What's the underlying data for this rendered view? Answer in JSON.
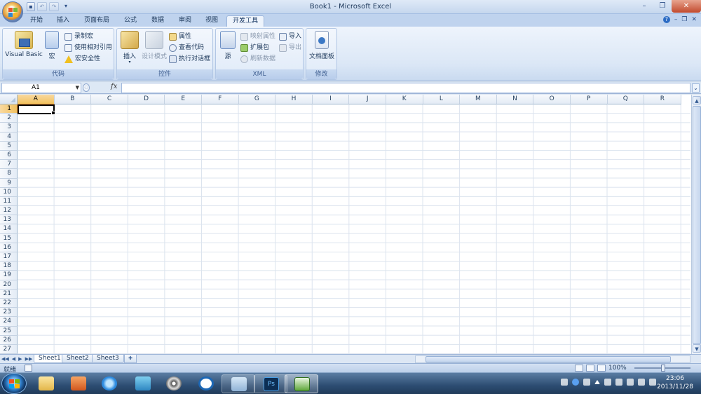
{
  "window": {
    "title": "Book1 - Microsoft Excel",
    "controls": {
      "minimize": "–",
      "restore": "❐",
      "close": "✕"
    }
  },
  "quick_access": {
    "save": "💾",
    "undo": "↶",
    "redo": "↷",
    "customize": "▾"
  },
  "ribbon_tabs": [
    {
      "label": "开始"
    },
    {
      "label": "插入"
    },
    {
      "label": "页面布局"
    },
    {
      "label": "公式"
    },
    {
      "label": "数据"
    },
    {
      "label": "审阅"
    },
    {
      "label": "视图"
    },
    {
      "label": "开发工具",
      "active": true
    }
  ],
  "ribbon_right": {
    "help": "?",
    "min": "–",
    "restore": "❐",
    "close": "✕"
  },
  "groups": {
    "code": {
      "label": "代码",
      "visual_basic": "Visual Basic",
      "macros": "宏",
      "record_macro": "录制宏",
      "relative_ref": "使用相对引用",
      "macro_security": "宏安全性"
    },
    "controls": {
      "label": "控件",
      "insert": "插入",
      "design_mode": "设计模式",
      "properties": "属性",
      "view_code": "查看代码",
      "run_dialog": "执行对话框"
    },
    "xml": {
      "label": "XML",
      "source": "源",
      "map_properties": "映射属性",
      "expansion_packs": "扩展包",
      "refresh_data": "刷新数据",
      "import": "导入",
      "export": "导出"
    },
    "modify": {
      "label": "修改",
      "document_panel": "文档面板"
    }
  },
  "formula_bar": {
    "name_box": "A1",
    "fx": "fx",
    "value": ""
  },
  "grid": {
    "columns": [
      "A",
      "B",
      "C",
      "D",
      "E",
      "F",
      "G",
      "H",
      "I",
      "J",
      "K",
      "L",
      "M",
      "N",
      "O",
      "P",
      "Q",
      "R"
    ],
    "rows": [
      "1",
      "2",
      "3",
      "4",
      "5",
      "6",
      "7",
      "8",
      "9",
      "10",
      "11",
      "12",
      "13",
      "14",
      "15",
      "16",
      "17",
      "18",
      "19",
      "20",
      "21",
      "22",
      "23",
      "24",
      "25",
      "26",
      "27"
    ],
    "selected_column": "A",
    "selected_row": "1"
  },
  "sheets": [
    {
      "label": "Sheet1",
      "active": true
    },
    {
      "label": "Sheet2"
    },
    {
      "label": "Sheet3"
    }
  ],
  "sheet_nav": [
    "◀◀",
    "◀",
    "▶",
    "▶▶"
  ],
  "status": {
    "ready": "就绪",
    "zoom": "100%"
  },
  "taskbar": {
    "clock_time": "23:06",
    "clock_date": "2013/11/28"
  },
  "colors": {
    "accent": "#1e395b",
    "selected_header": "#f1c15f",
    "gridline": "#dbe3ee"
  }
}
